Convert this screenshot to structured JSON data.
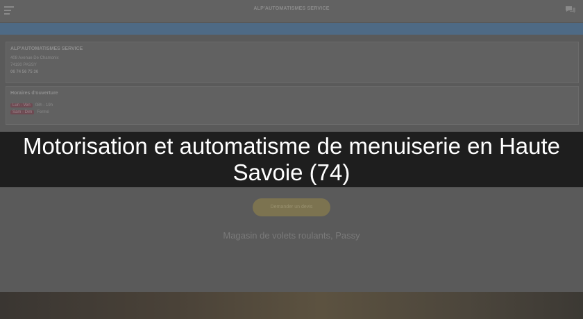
{
  "header": {
    "site_title": "ALP'AUTOMATISMES SERVICE",
    "menu_icon": "hamburger-menu-icon",
    "chat_icon": "chat-bubbles-icon"
  },
  "banner": {
    "text": ""
  },
  "contact_card": {
    "company": "ALP'AUTOMATISMES SERVICE",
    "address_line1": "408 Avenue De Chamonix",
    "address_line2": "74190 PASSY",
    "phone": "06 74 56 75 36"
  },
  "hours_card": {
    "title": "Horaires d'ouverture",
    "rows": [
      {
        "days": "Lun - Ven",
        "hours": "08h - 19h"
      },
      {
        "days": "Sam - Dim",
        "hours": "Fermé"
      }
    ]
  },
  "cta": {
    "quote_button": "Demander un devis"
  },
  "shop": {
    "title": "Magasin de volets roulants, Passy",
    "description": ""
  },
  "overlay": {
    "caption": "Motorisation et automatisme de menuiserie en Haute Savoie (74)"
  },
  "colors": {
    "banner": "#4e6a85",
    "button": "#7c7350",
    "caption_text": "#ffffff",
    "caption_band": "#000000"
  }
}
